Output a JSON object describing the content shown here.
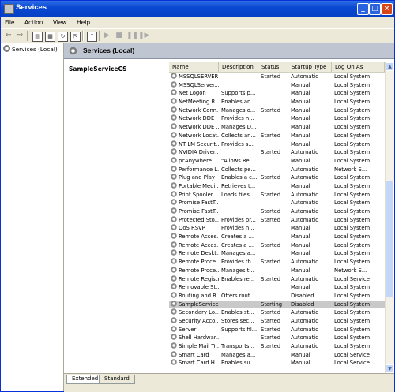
{
  "window": {
    "title": "Services"
  },
  "menu": [
    "File",
    "Action",
    "View",
    "Help"
  ],
  "toolbar": {
    "buttons": [
      "back-icon",
      "forward-icon",
      "show-hide-tree-icon",
      "properties-icon",
      "refresh-icon",
      "export-list-icon",
      "help-icon",
      "start-icon",
      "stop-icon",
      "pause-icon",
      "restart-icon"
    ]
  },
  "tree": {
    "root": "Services (Local)"
  },
  "pane": {
    "title": "Services (Local)",
    "selected_service": "SampleServiceCS"
  },
  "columns": {
    "name": "Name",
    "description": "Description",
    "status": "Status",
    "startup": "Startup Type",
    "logon": "Log On As"
  },
  "rows": [
    {
      "name": "MSSQLSERVER",
      "desc": "",
      "status": "Started",
      "startup": "Automatic",
      "logon": "Local System"
    },
    {
      "name": "MSSQLServer...",
      "desc": "",
      "status": "",
      "startup": "Manual",
      "logon": "Local System"
    },
    {
      "name": "Net Logon",
      "desc": "Supports p...",
      "status": "",
      "startup": "Manual",
      "logon": "Local System"
    },
    {
      "name": "NetMeeting R...",
      "desc": "Enables an...",
      "status": "",
      "startup": "Manual",
      "logon": "Local System"
    },
    {
      "name": "Network Conn...",
      "desc": "Manages o...",
      "status": "Started",
      "startup": "Manual",
      "logon": "Local System"
    },
    {
      "name": "Network DDE",
      "desc": "Provides n...",
      "status": "",
      "startup": "Manual",
      "logon": "Local System"
    },
    {
      "name": "Network DDE ...",
      "desc": "Manages D...",
      "status": "",
      "startup": "Manual",
      "logon": "Local System"
    },
    {
      "name": "Network Locat...",
      "desc": "Collects an...",
      "status": "Started",
      "startup": "Manual",
      "logon": "Local System"
    },
    {
      "name": "NT LM Securit...",
      "desc": "Provides s...",
      "status": "",
      "startup": "Manual",
      "logon": "Local System"
    },
    {
      "name": "NVIDIA Driver...",
      "desc": "",
      "status": "Started",
      "startup": "Automatic",
      "logon": "Local System"
    },
    {
      "name": "pcAnywhere ...",
      "desc": "\"Allows Re...",
      "status": "",
      "startup": "Manual",
      "logon": "Local System"
    },
    {
      "name": "Performance L...",
      "desc": "Collects pe...",
      "status": "",
      "startup": "Automatic",
      "logon": "Network S..."
    },
    {
      "name": "Plug and Play",
      "desc": "Enables a c...",
      "status": "Started",
      "startup": "Automatic",
      "logon": "Local System"
    },
    {
      "name": "Portable Medi...",
      "desc": "Retrieves t...",
      "status": "",
      "startup": "Manual",
      "logon": "Local System"
    },
    {
      "name": "Print Spooler",
      "desc": "Loads files ...",
      "status": "Started",
      "startup": "Automatic",
      "logon": "Local System"
    },
    {
      "name": "Promise FastT...",
      "desc": "",
      "status": "",
      "startup": "Automatic",
      "logon": "Local System"
    },
    {
      "name": "Promise FastT...",
      "desc": "",
      "status": "Started",
      "startup": "Automatic",
      "logon": "Local System"
    },
    {
      "name": "Protected Sto...",
      "desc": "Provides pr...",
      "status": "Started",
      "startup": "Automatic",
      "logon": "Local System"
    },
    {
      "name": "QoS RSVP",
      "desc": "Provides n...",
      "status": "",
      "startup": "Manual",
      "logon": "Local System"
    },
    {
      "name": "Remote Acces...",
      "desc": "Creates a ...",
      "status": "",
      "startup": "Manual",
      "logon": "Local System"
    },
    {
      "name": "Remote Acces...",
      "desc": "Creates a ...",
      "status": "Started",
      "startup": "Manual",
      "logon": "Local System"
    },
    {
      "name": "Remote Deskt...",
      "desc": "Manages a...",
      "status": "",
      "startup": "Manual",
      "logon": "Local System"
    },
    {
      "name": "Remote Proce...",
      "desc": "Provides th...",
      "status": "Started",
      "startup": "Automatic",
      "logon": "Local System"
    },
    {
      "name": "Remote Proce...",
      "desc": "Manages t...",
      "status": "",
      "startup": "Manual",
      "logon": "Network S..."
    },
    {
      "name": "Remote Registry",
      "desc": "Enables re...",
      "status": "Started",
      "startup": "Automatic",
      "logon": "Local Service"
    },
    {
      "name": "Removable St...",
      "desc": "",
      "status": "",
      "startup": "Manual",
      "logon": "Local System"
    },
    {
      "name": "Routing and R...",
      "desc": "Offers rout...",
      "status": "",
      "startup": "Disabled",
      "logon": "Local System"
    },
    {
      "name": "SampleService...",
      "desc": "",
      "status": "Starting",
      "startup": "Disabled",
      "logon": "Local System",
      "selected": true
    },
    {
      "name": "Secondary Lo...",
      "desc": "Enables st...",
      "status": "Started",
      "startup": "Automatic",
      "logon": "Local System"
    },
    {
      "name": "Security Acco...",
      "desc": "Stores sec...",
      "status": "Started",
      "startup": "Automatic",
      "logon": "Local System"
    },
    {
      "name": "Server",
      "desc": "Supports fil...",
      "status": "Started",
      "startup": "Automatic",
      "logon": "Local System"
    },
    {
      "name": "Shell Hardwar...",
      "desc": "",
      "status": "Started",
      "startup": "Automatic",
      "logon": "Local System"
    },
    {
      "name": "Simple Mail Tr...",
      "desc": "Transports...",
      "status": "Started",
      "startup": "Automatic",
      "logon": "Local System"
    },
    {
      "name": "Smart Card",
      "desc": "Manages a...",
      "status": "",
      "startup": "Manual",
      "logon": "Local Service"
    },
    {
      "name": "Smart Card H...",
      "desc": "Enables su...",
      "status": "",
      "startup": "Manual",
      "logon": "Local Service"
    }
  ],
  "tabs": [
    "Extended",
    "Standard"
  ]
}
